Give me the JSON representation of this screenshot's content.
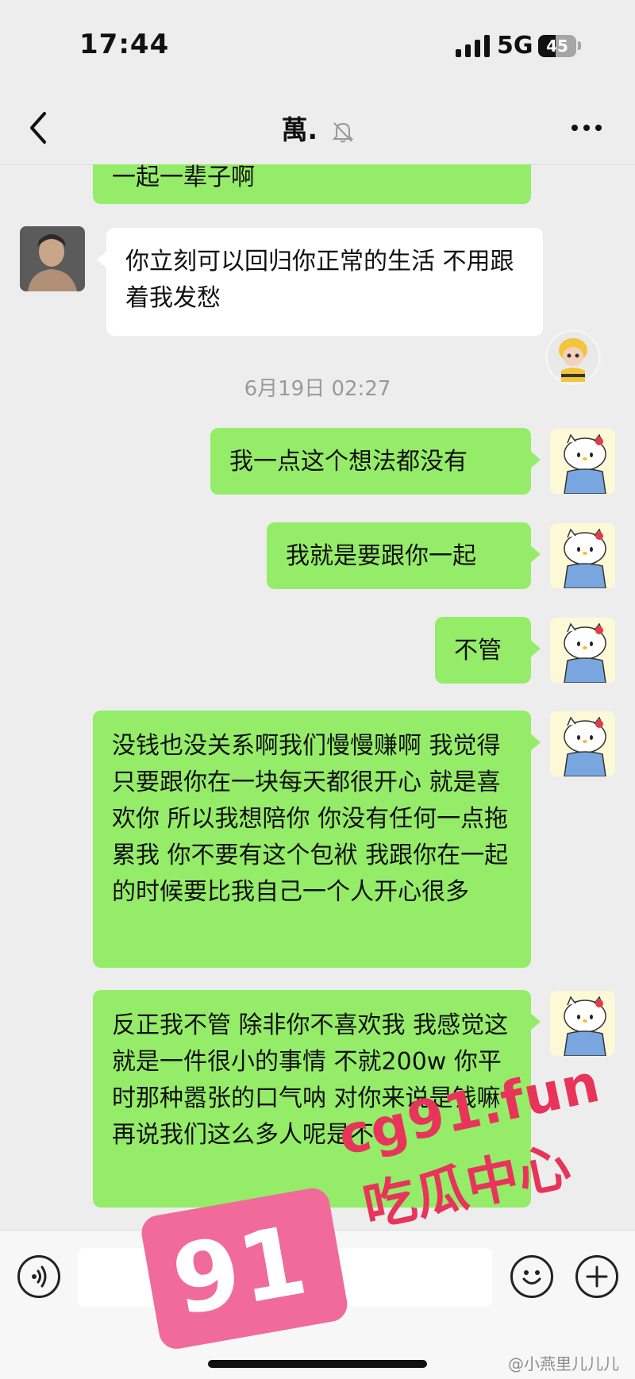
{
  "status_bar": {
    "time": "17:44",
    "network": "5G",
    "battery": "45"
  },
  "nav": {
    "title": "萬."
  },
  "messages": [
    {
      "side": "right",
      "text": "一起一辈子啊"
    },
    {
      "side": "left",
      "text": "你立刻可以回归你正常的生活 不用跟着我发愁"
    },
    {
      "side": "right",
      "text": "我一点这个想法都没有"
    },
    {
      "side": "right",
      "text": "我就是要跟你一起"
    },
    {
      "side": "right",
      "text": "不管"
    },
    {
      "side": "right",
      "text": "没钱也没关系啊我们慢慢赚啊 我觉得只要跟你在一块每天都很开心 就是喜欢你 所以我想陪你 你没有任何一点拖累我 你不要有这个包袱 我跟你在一起的时候要比我自己一个人开心很多"
    },
    {
      "side": "right",
      "text": "反正我不管 除非你不喜欢我 我感觉这就是一件很小的事情 不就200w 你平时那种嚣张的口气呐 对你来说是钱嘛 再说我们这么多人呢是不"
    }
  ],
  "timestamp": "6月19日 02:27",
  "watermark": {
    "url": "cg91.fun",
    "site": "吃瓜中心",
    "logo": "91",
    "user": "@小燕里儿儿儿"
  },
  "icons": [
    "back-chevron-icon",
    "mute-bell-icon",
    "more-dots-icon",
    "voice-icon",
    "emoji-icon",
    "plus-icon"
  ],
  "colors": {
    "bg": "#ededed",
    "bubble_me": "#95ec69",
    "bubble_friend": "#ffffff",
    "watermark": "#e8345a"
  }
}
